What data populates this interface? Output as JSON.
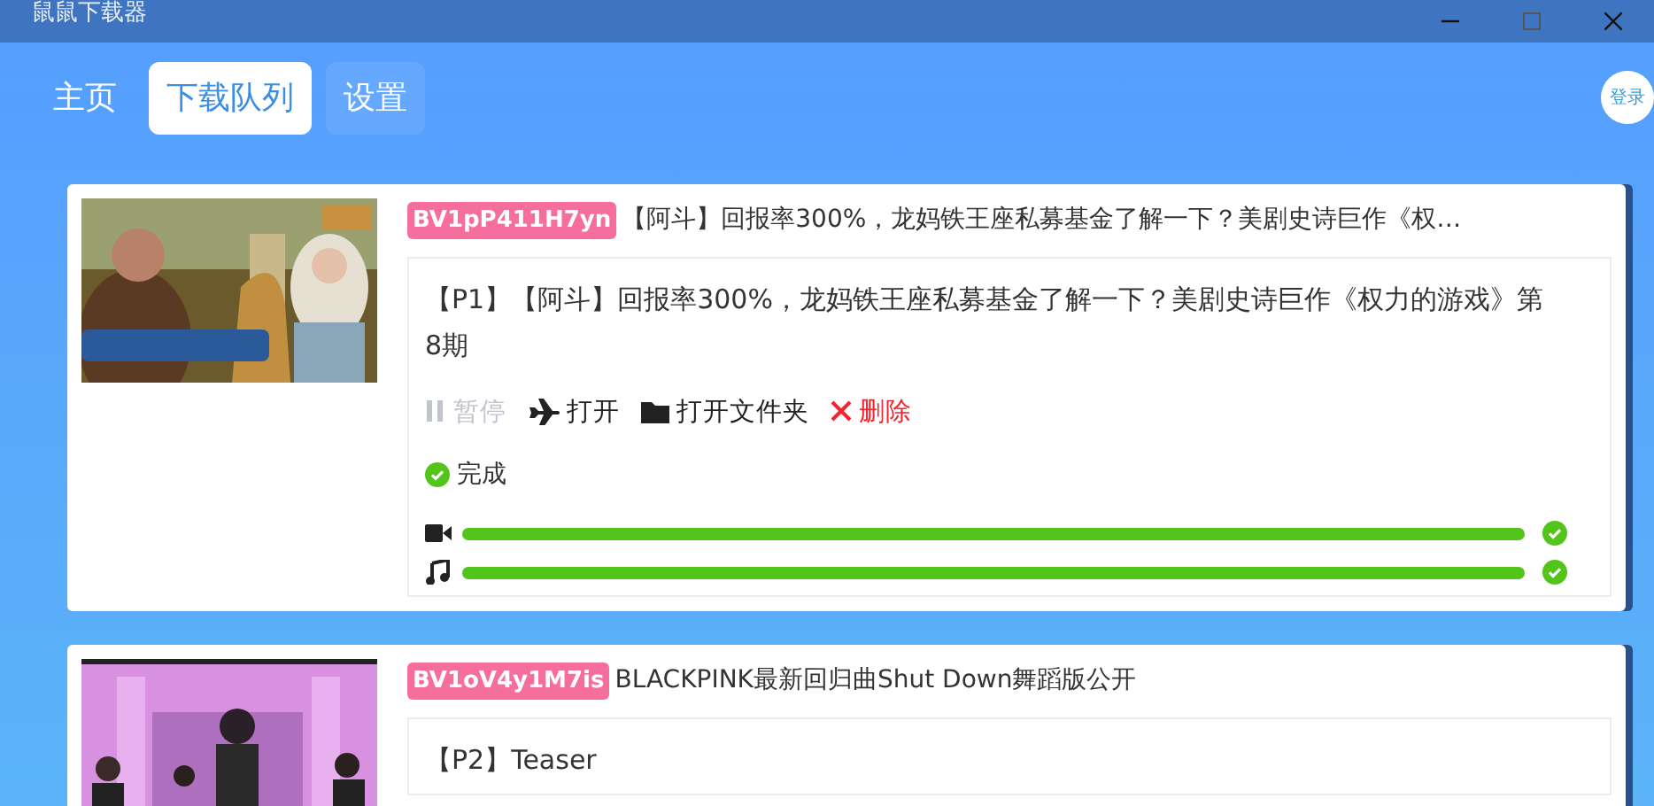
{
  "window": {
    "title": "鼠鼠下载器"
  },
  "tabs": [
    {
      "label": "主页",
      "selected": false
    },
    {
      "label": "下载队列",
      "selected": true
    },
    {
      "label": "设置",
      "selected": false
    }
  ],
  "login": {
    "label": "登录"
  },
  "queue": [
    {
      "bvid": "BV1pP411H7yn",
      "title": "【阿斗】回报率300%，龙妈铁王座私募基金了解一下？美剧史诗巨作《权…",
      "thumbnail": {
        "kind": "picture"
      },
      "parts": [
        {
          "label": "【P1】【阿斗】回报率300%，龙妈铁王座私募基金了解一下？美剧史诗巨作《权力的游戏》第8期",
          "actions": [
            {
              "kind": "pause",
              "label": "暂停",
              "disabled": true
            },
            {
              "kind": "open",
              "label": "打开",
              "disabled": false
            },
            {
              "kind": "folder",
              "label": "打开文件夹",
              "disabled": false
            },
            {
              "kind": "delete",
              "label": "删除",
              "disabled": false
            }
          ],
          "status": {
            "label": "完成",
            "done": true
          },
          "progress": [
            {
              "kind": "video",
              "level": 1,
              "done": true
            },
            {
              "kind": "audio",
              "level": 1,
              "done": true
            }
          ]
        }
      ]
    },
    {
      "bvid": "BV1oV4y1M7is",
      "title": "BLACKPINK最新回归曲Shut Down舞蹈版公开",
      "thumbnail": {
        "kind": "picture"
      },
      "parts": [
        {
          "label": "【P2】Teaser"
        }
      ]
    }
  ]
}
